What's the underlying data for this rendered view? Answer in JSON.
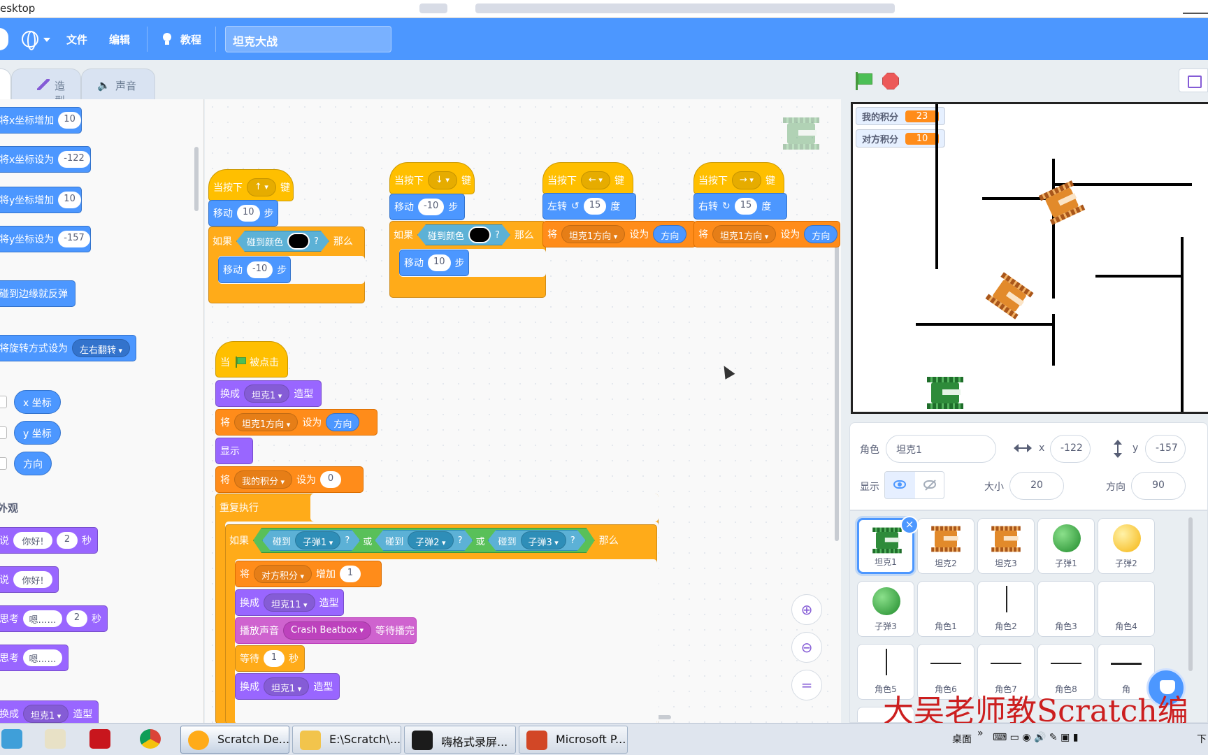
{
  "window": {
    "title": "esktop"
  },
  "menubar": {
    "file": "文件",
    "edit": "编辑",
    "tutorial": "教程",
    "project_name": "坦克大战"
  },
  "tabs": {
    "costumes": "造型",
    "sounds": "声音"
  },
  "palette": {
    "motion": [
      {
        "text": "将x坐标增加",
        "value": "10"
      },
      {
        "text": "将x坐标设为",
        "value": "-122"
      },
      {
        "text": "将y坐标增加",
        "value": "10"
      },
      {
        "text": "将y坐标设为",
        "value": "-157"
      }
    ],
    "bounce": "碰到边缘就反弹",
    "rotation": {
      "text": "将旋转方式设为",
      "option": "左右翻转"
    },
    "reporters": [
      "x 坐标",
      "y 坐标",
      "方向"
    ],
    "looks_label": "外观",
    "looks": [
      {
        "a": "说",
        "msg": "你好!",
        "secs": "2",
        "unit": "秒"
      },
      {
        "a": "说",
        "msg": "你好!"
      },
      {
        "a": "思考",
        "msg": "嗯……",
        "secs": "2",
        "unit": "秒"
      },
      {
        "a": "思考",
        "msg": "嗯……"
      }
    ],
    "switch_costume": {
      "a": "换成",
      "option": "坦克1",
      "b": "造型"
    }
  },
  "scripts": {
    "up": {
      "when": "当按下",
      "key": "↑",
      "key_suffix": "键",
      "move": "移动",
      "steps": "10",
      "steps_unit": "步",
      "if": "如果",
      "touch_color": "碰到颜色",
      "q": "?",
      "then": "那么",
      "back": "-10"
    },
    "down": {
      "key": "↓",
      "steps": "-10",
      "back": "10"
    },
    "left": {
      "key": "←",
      "turn": "左转",
      "deg": "15",
      "deg_unit": "度",
      "set": "将",
      "var": "坦克1方向",
      "to": "设为",
      "dir": "方向"
    },
    "right": {
      "key": "→",
      "turn": "右转"
    },
    "main": {
      "when": "当",
      "clicked": "被点击",
      "costume1": "换成",
      "costume1_opt": "坦克1",
      "costume1_b": "造型",
      "set_var": "坦克1方向",
      "dir": "方向",
      "show": "显示",
      "score_var": "我的积分",
      "score_val": "0",
      "forever": "重复执行",
      "touch": "碰到",
      "bullet1": "子弹1",
      "bullet2": "子弹2",
      "bullet3": "子弹3",
      "or": "或",
      "change": "增加",
      "opp_var": "对方积分",
      "change_val": "1",
      "costume2_opt": "坦克11",
      "play": "播放声音",
      "sound": "Crash Beatbox",
      "until_done": "等待播完",
      "wait": "等待",
      "wait_val": "1",
      "wait_unit": "秒"
    }
  },
  "stage": {
    "monitors": [
      {
        "label": "我的积分",
        "value": "23"
      },
      {
        "label": "对方积分",
        "value": "10"
      }
    ]
  },
  "sprite_info": {
    "sprite_label": "角色",
    "sprite_name": "坦克1",
    "x_label": "x",
    "x": "-122",
    "y_label": "y",
    "y": "-157",
    "show_label": "显示",
    "size_label": "大小",
    "size": "20",
    "direction_label": "方向",
    "direction": "90"
  },
  "sprites": [
    "坦克1",
    "坦克2",
    "坦克3",
    "子弹1",
    "子弹2",
    "子弹3",
    "角色1",
    "角色2",
    "角色3",
    "角色4",
    "角色5",
    "角色6",
    "角色7",
    "角色8",
    "角"
  ],
  "watermark": "大吴老师教Scratch编",
  "taskbar": {
    "items": [
      "Scratch De...",
      "E:\\Scratch\\...",
      "嗨格式录屏...",
      "Microsoft P..."
    ],
    "desktop": "桌面",
    "corner": "下"
  },
  "colors": {
    "accent": "#4c97ff",
    "events": "#ffbf00",
    "motion": "#4c97ff",
    "looks": "#9966ff",
    "variables": "#ff8c1a",
    "control": "#ffab19",
    "sensing": "#5cb1d6"
  }
}
